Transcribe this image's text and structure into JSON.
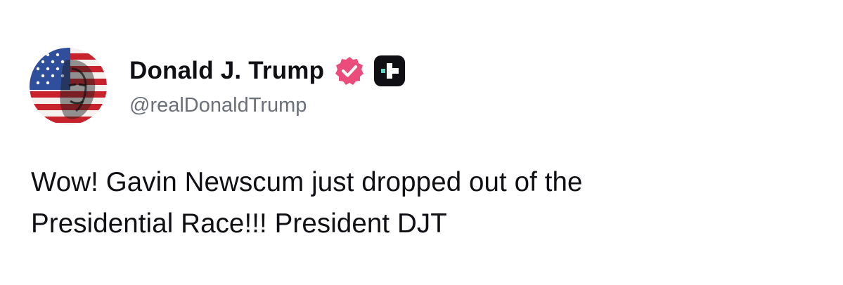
{
  "author": {
    "display_name": "Donald J. Trump",
    "handle": "@realDonaldTrump",
    "avatar_icon": "flag-portrait-avatar",
    "verified_icon": "verified-badge-icon",
    "verified_color": "#ea4c7c",
    "platform_icon": "truth-social-logo-icon",
    "platform_icon_bg": "#0f0f14",
    "platform_icon_accent": "#5fd3c6"
  },
  "post": {
    "lines": [
      "Wow! Gavin Newscum just dropped out of the",
      "Presidential Race!!! President DJT"
    ]
  },
  "colors": {
    "text": "#0f0f14",
    "handle": "#6b6f78",
    "background": "#ffffff"
  }
}
